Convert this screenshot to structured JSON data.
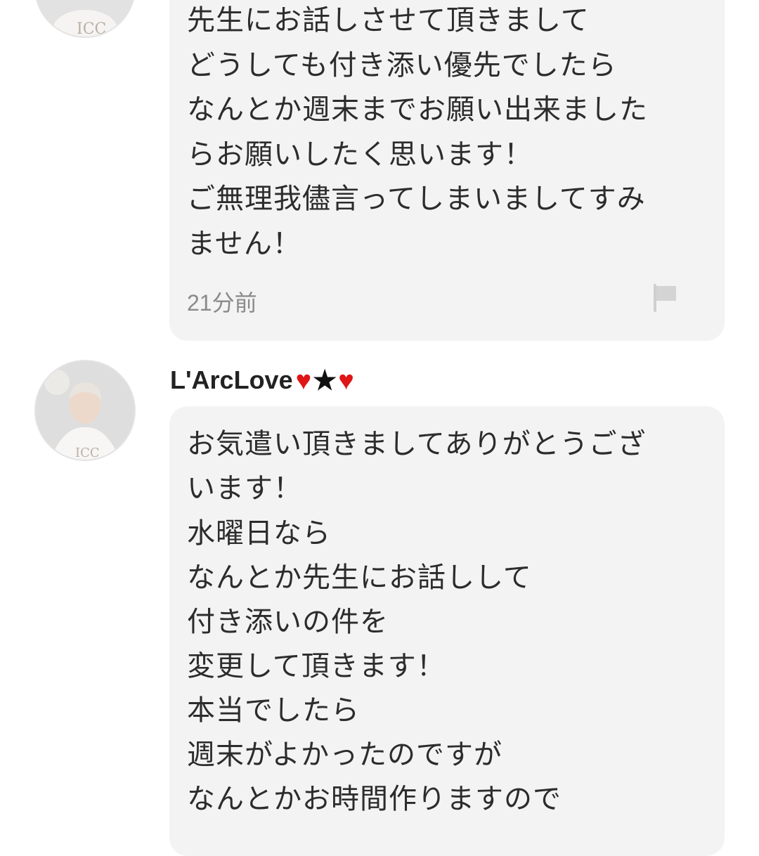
{
  "thread": [
    {
      "id": "comment-1",
      "author": "",
      "lines": [
        "先生にお話しさせて頂きまして",
        "どうしても付き添い優先でしたら",
        "なんとか週末までお願い出来ました",
        "らお願いしたく思います！",
        "ご無理我儘言ってしまいましてすみ",
        "ません！"
      ],
      "time": "21分前",
      "flag_icon": "flag-icon"
    },
    {
      "id": "comment-2",
      "author_name": "L'ArcLove",
      "author_deco": [
        "♥",
        "★",
        "♥"
      ],
      "lines": [
        "お気遣い頂きましてありがとうござ",
        "います！",
        "水曜日なら",
        "なんとか先生にお話しして",
        "付き添いの件を",
        "変更して頂きます！",
        "本当でしたら",
        "週末がよかったのですが",
        "なんとかお時間作りますので"
      ]
    }
  ],
  "colors": {
    "bubble_bg": "#f3f3f3",
    "text": "#2c2c2c",
    "timestamp": "#8a8a8a",
    "heart": "#e01515"
  }
}
